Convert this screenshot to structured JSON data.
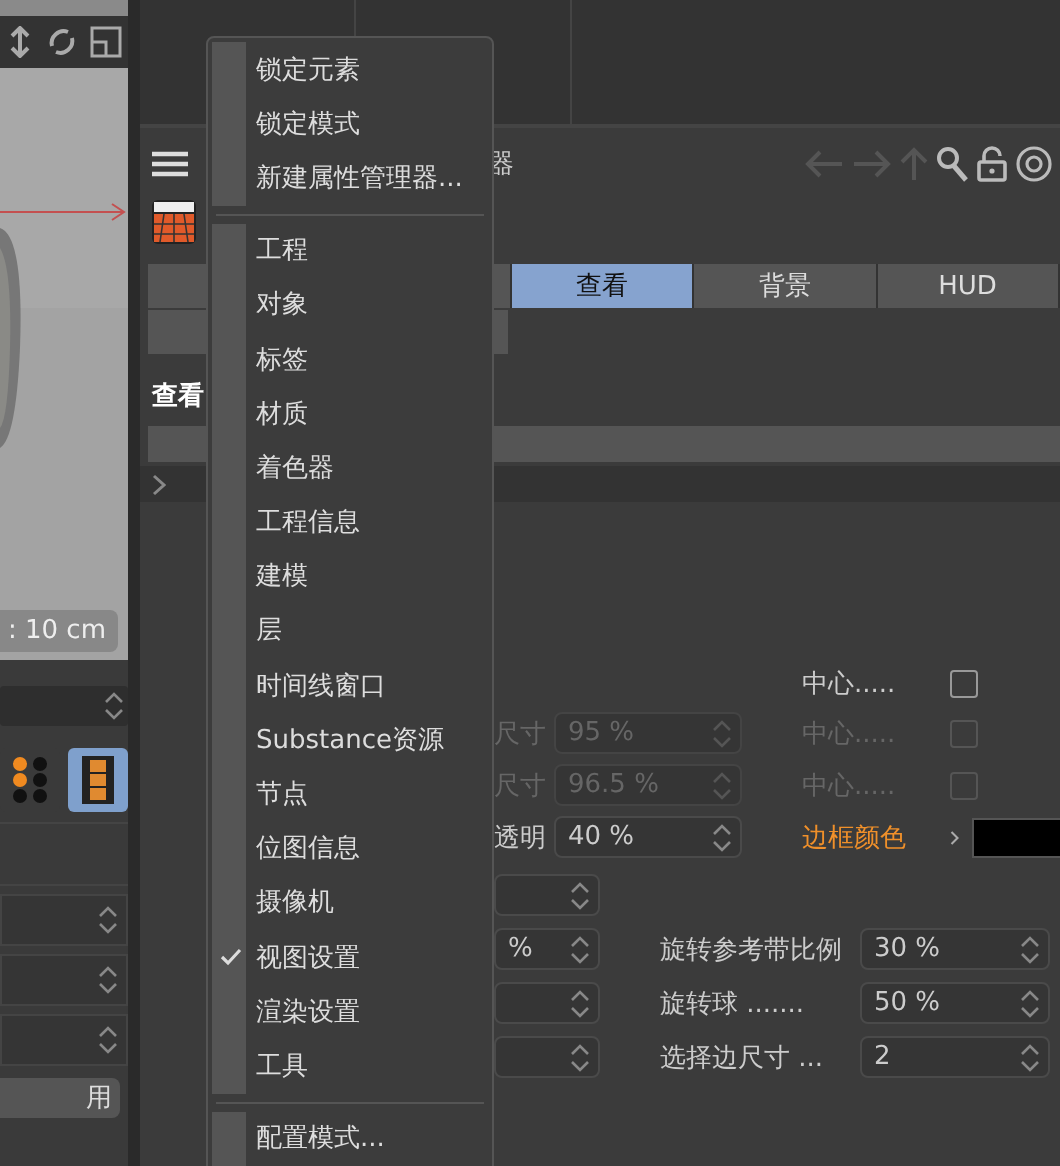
{
  "viewport": {
    "scale_label": ": 10 cm"
  },
  "left_tools": [
    {
      "kind": "dots",
      "selected": false
    },
    {
      "kind": "film",
      "selected": true
    }
  ],
  "left_button": {
    "label": "用"
  },
  "panel": {
    "title": "器",
    "heading": "查看",
    "tabs": [
      {
        "label": "查看",
        "selected": true
      },
      {
        "label": "背景",
        "selected": false
      },
      {
        "label": "HUD",
        "selected": false
      }
    ]
  },
  "upper_rows": [
    {
      "label": "尺寸",
      "value": "95 %",
      "disabled": true,
      "check_label": "中心.....",
      "checked": false,
      "check_disabled": true
    },
    {
      "label": "尺寸",
      "value": "96.5 %",
      "disabled": true,
      "check_label": "中心.....",
      "checked": false,
      "check_disabled": true
    },
    {
      "label": "透明",
      "value": "40 %",
      "disabled": false,
      "color_label": "边框颜色"
    }
  ],
  "first_check": {
    "label": "中心.....",
    "checked": false,
    "disabled": false
  },
  "short_fields": [
    {
      "kind": "blank"
    },
    {
      "kind": "text",
      "value": "%"
    },
    {
      "kind": "blank"
    },
    {
      "kind": "blank"
    }
  ],
  "lower_rows": [
    {
      "label": "旋转参考带比例",
      "value": "30 %"
    },
    {
      "label": "旋转球 .......",
      "value": "50 %"
    },
    {
      "label": "选择边尺寸 ...",
      "value": "2"
    }
  ],
  "menu": {
    "groups": [
      [
        {
          "label": "锁定元素",
          "checked": false
        },
        {
          "label": "锁定模式",
          "checked": false
        },
        {
          "label": "新建属性管理器...",
          "checked": false
        }
      ],
      [
        {
          "label": "工程",
          "checked": false
        },
        {
          "label": "对象",
          "checked": false
        },
        {
          "label": "标签",
          "checked": false
        },
        {
          "label": "材质",
          "checked": false
        },
        {
          "label": "着色器",
          "checked": false
        },
        {
          "label": "工程信息",
          "checked": false
        },
        {
          "label": "建模",
          "checked": false
        },
        {
          "label": "层",
          "checked": false
        },
        {
          "label": "时间线窗口",
          "checked": false
        },
        {
          "label": "Substance资源",
          "checked": false
        },
        {
          "label": "节点",
          "checked": false
        },
        {
          "label": "位图信息",
          "checked": false
        },
        {
          "label": "摄像机",
          "checked": false
        },
        {
          "label": "视图设置",
          "checked": true
        },
        {
          "label": "渲染设置",
          "checked": false
        },
        {
          "label": "工具",
          "checked": false
        }
      ],
      [
        {
          "label": "配置模式...",
          "checked": false
        }
      ]
    ]
  }
}
